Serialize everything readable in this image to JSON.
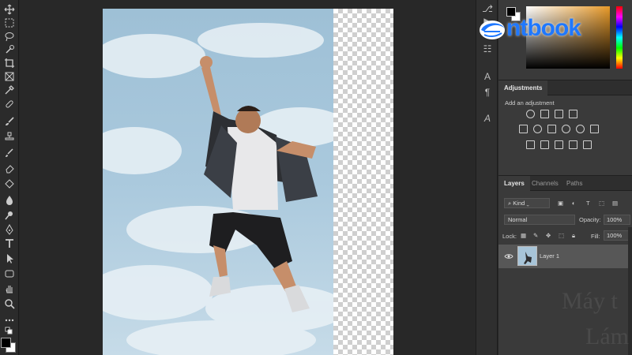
{
  "logo": {
    "text": "ntbook",
    "icon": "ntbook-logo-icon",
    "color": "#1f78ff"
  },
  "side_strip": {
    "icons": [
      "A",
      "¶",
      "A"
    ]
  },
  "adjustments": {
    "tab": "Adjustments",
    "add_label": "Add an adjustment"
  },
  "layers_panel": {
    "tabs": [
      "Layers",
      "Channels",
      "Paths"
    ],
    "filter_kind": "Kind",
    "blend_mode": "Normal",
    "opacity_label": "Opacity:",
    "opacity_value": "100%",
    "lock_label": "Lock:",
    "fill_label": "Fill:",
    "fill_value": "100%",
    "layers": [
      {
        "name": "Layer 1",
        "visible": true
      }
    ]
  },
  "colors": {
    "accent": "#1f78ff",
    "panel_bg": "#3a3a3a",
    "workspace_bg": "#282828"
  },
  "ghost_text": [
    "Máy t",
    "Lám"
  ]
}
